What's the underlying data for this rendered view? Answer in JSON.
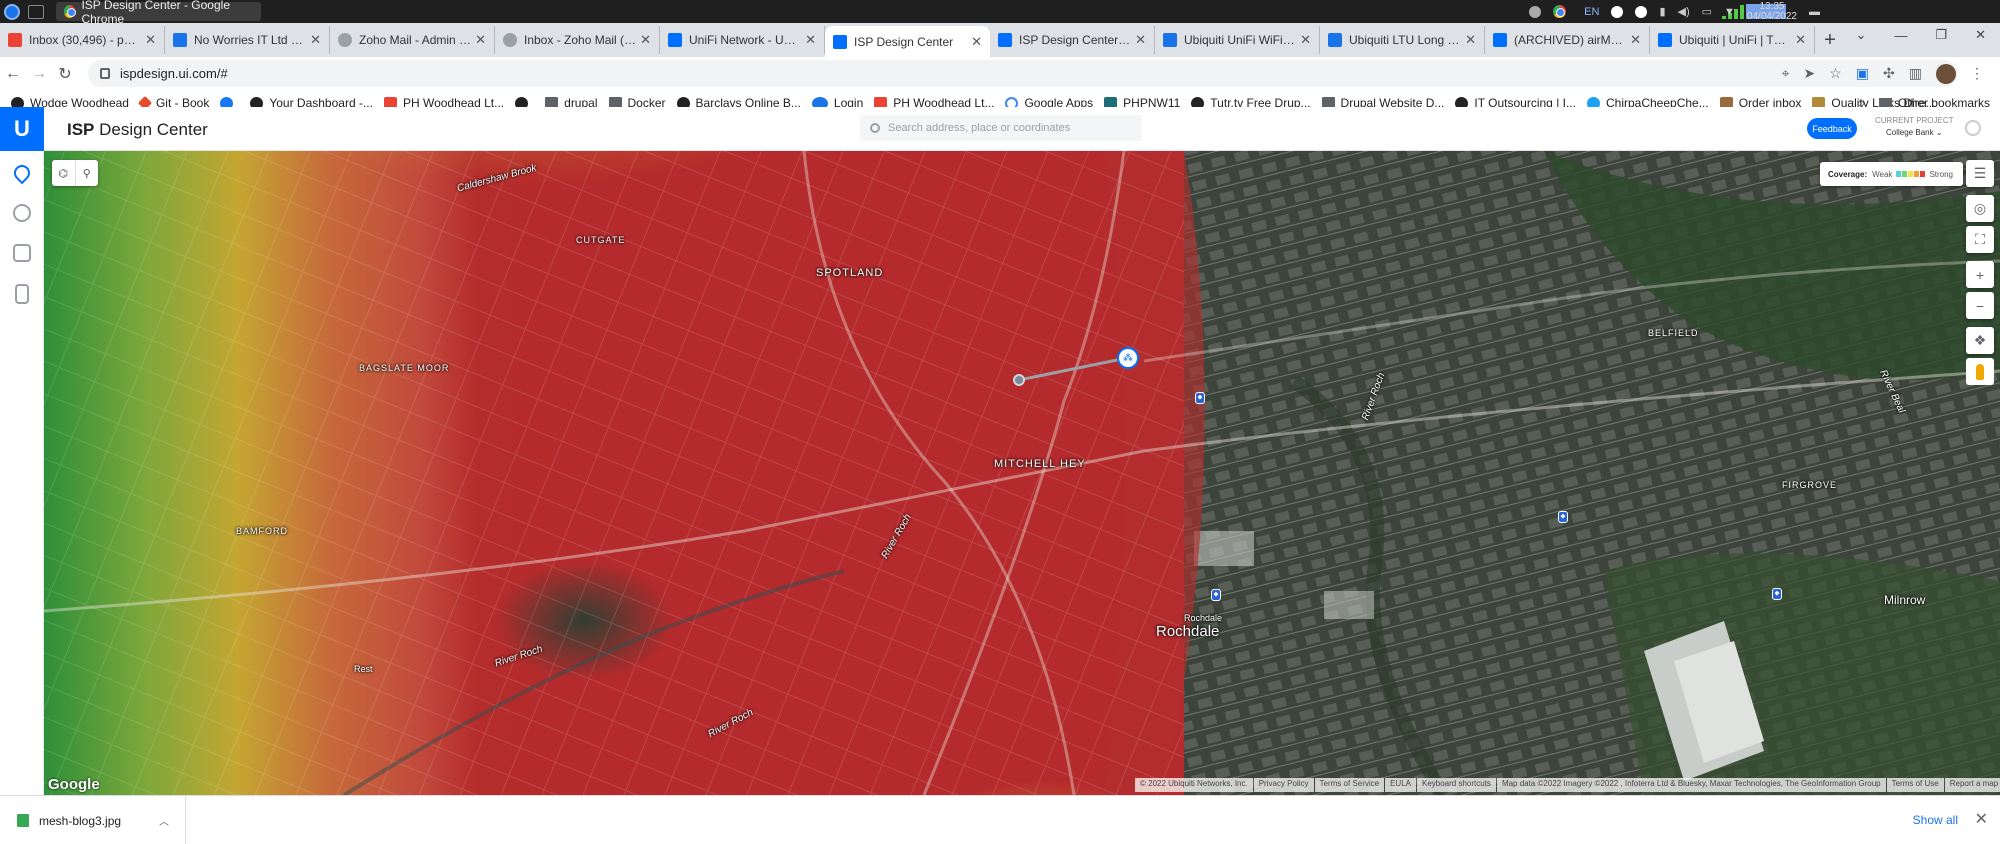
{
  "window": {
    "title": "ISP Design Center - Google Chrome",
    "tray_lang": "EN",
    "time": "13:35",
    "date": "04/04/2022"
  },
  "tabs": [
    {
      "label": "Inbox (30,496) - paul@n...",
      "favicon_color": "#ea4335"
    },
    {
      "label": "No Worries IT Ltd – Cale...",
      "favicon_color": "#1a73e8"
    },
    {
      "label": "Zoho Mail - Admin Cons...",
      "favicon_color": "#9aa0a6"
    },
    {
      "label": "Inbox - Zoho Mail (paul...",
      "favicon_color": "#9aa0a6"
    },
    {
      "label": "UniFi Network - UDMPR...",
      "favicon_color": "#006fff"
    },
    {
      "label": "ISP Design Center",
      "favicon_color": "#006fff",
      "active": true
    },
    {
      "label": "ISP Design Center | Ubi...",
      "favicon_color": "#006fff"
    },
    {
      "label": "Ubiquiti UniFi WiFi Base...",
      "favicon_color": "#1a73e8"
    },
    {
      "label": "Ubiquiti LTU Long Rang...",
      "favicon_color": "#1a73e8"
    },
    {
      "label": "(ARCHIVED) airMAX - Co...",
      "favicon_color": "#006fff"
    },
    {
      "label": "Ubiquiti | UniFi | The sta...",
      "favicon_color": "#006fff"
    }
  ],
  "omnibox": {
    "url": "ispdesign.ui.com/#"
  },
  "bookmarks": [
    {
      "label": "Wodge Woodhead",
      "icon": "globe-icon"
    },
    {
      "label": "Git - Book",
      "icon": "git-icon"
    },
    {
      "label": "",
      "icon": "facebook-icon"
    },
    {
      "label": "Your Dashboard -...",
      "icon": "github-icon"
    },
    {
      "label": "PH Woodhead Lt...",
      "icon": "gmail-icon"
    },
    {
      "label": "",
      "icon": "globe-icon"
    },
    {
      "label": "drupal",
      "icon": "folder-icon"
    },
    {
      "label": "Docker",
      "icon": "folder-icon"
    },
    {
      "label": "Barclays Online B...",
      "icon": "globe-icon"
    },
    {
      "label": "Login",
      "icon": "login-icon"
    },
    {
      "label": "PH Woodhead Lt...",
      "icon": "gmail-icon"
    },
    {
      "label": "Google Apps",
      "icon": "google-icon"
    },
    {
      "label": "PHPNW11",
      "icon": "phpnw-icon"
    },
    {
      "label": "Tutr.tv Free Drup...",
      "icon": "globe-icon"
    },
    {
      "label": "Drupal Website D...",
      "icon": "folder-icon"
    },
    {
      "label": "IT Outsourcing | I...",
      "icon": "globe-icon"
    },
    {
      "label": "ChirpaCheepChe...",
      "icon": "twitter-icon"
    },
    {
      "label": "Order inbox",
      "icon": "shop-icon"
    },
    {
      "label": "Quality Links Dire...",
      "icon": "globe-icon"
    }
  ],
  "other_bookmarks": "Other bookmarks",
  "app": {
    "title_prefix": "ISP",
    "title_rest": "Design Center",
    "search_placeholder": "Search address, place or coordinates",
    "feedback": "Feedback",
    "project_label": "CURRENT PROJECT",
    "project_name": "College Bank"
  },
  "map": {
    "coverage_label": "Coverage:",
    "weak": "Weak",
    "strong": "Strong",
    "coverage_colors": [
      "#4fd6d6",
      "#6fd66f",
      "#f1e24a",
      "#f39a3a",
      "#e0413a"
    ],
    "labels": [
      {
        "text": "Caldershaw Brook",
        "kind": "river"
      },
      {
        "text": "CUTGATE",
        "kind": "area"
      },
      {
        "text": "SPOTLAND",
        "kind": "big"
      },
      {
        "text": "BAGSLATE MOOR",
        "kind": "area"
      },
      {
        "text": "MITCHELL HEY",
        "kind": "big"
      },
      {
        "text": "BAMFORD",
        "kind": "area"
      },
      {
        "text": "River Roch",
        "kind": "river"
      },
      {
        "text": "River Roch",
        "kind": "river"
      },
      {
        "text": "River Roch",
        "kind": "river"
      },
      {
        "text": "Rochdale",
        "kind": "small"
      },
      {
        "text": "Rochdale",
        "kind": "town"
      },
      {
        "text": "BELFIELD",
        "kind": "area"
      },
      {
        "text": "River Roch",
        "kind": "river"
      },
      {
        "text": "FIRGROVE",
        "kind": "area"
      },
      {
        "text": "Milnrow",
        "kind": "town"
      },
      {
        "text": "River Beal",
        "kind": "river"
      },
      {
        "text": "Rest",
        "kind": "small"
      }
    ],
    "google": "Google",
    "attribution": [
      "© 2022 Ubiquiti Networks, Inc.",
      "Privacy Policy",
      "Terms of Service",
      "EULA",
      "Keyboard shortcuts",
      "Map data ©2022 Imagery ©2022 , Infoterra Ltd & Bluesky, Maxar Technologies, The GeoInformation Group",
      "Terms of Use",
      "Report a map error"
    ]
  },
  "downloads": {
    "file": "mesh-blog3.jpg",
    "show_all": "Show all"
  }
}
